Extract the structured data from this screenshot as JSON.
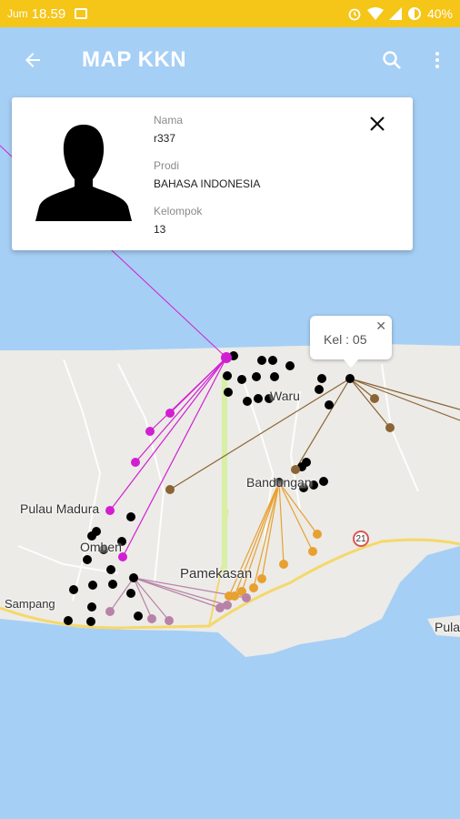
{
  "status_bar": {
    "carrier": "Jum",
    "time": "18.59",
    "battery": "40%",
    "icons": [
      "image-icon",
      "alarm-icon",
      "wifi-icon",
      "signal-icon",
      "battery-icon"
    ]
  },
  "app_bar": {
    "title": "MAP KKN",
    "back_icon": "arrow-back-icon",
    "search_icon": "search-icon",
    "menu_icon": "more-vert-icon"
  },
  "info_card": {
    "nama_label": "Nama",
    "nama_value": "r337",
    "prodi_label": "Prodi",
    "prodi_value": "BAHASA INDONESIA",
    "kelompok_label": "Kelompok",
    "kelompok_value": "13",
    "close_icon": "close-icon"
  },
  "callout": {
    "text": "Kel : 05",
    "close": "✕"
  },
  "map": {
    "labels": [
      "Waru",
      "Bandungan",
      "Pulau Madura",
      "Omben",
      "Pamekasan",
      "Sampang",
      "Pula"
    ],
    "road_sign": "21",
    "colors": {
      "water": "#a6cff5",
      "land": "#ecebe7",
      "marker_black": "#000000",
      "marker_magenta": "#d21ed2",
      "marker_brown": "#8a6434",
      "marker_orange": "#e8a030",
      "marker_mauve": "#b882a8"
    }
  }
}
